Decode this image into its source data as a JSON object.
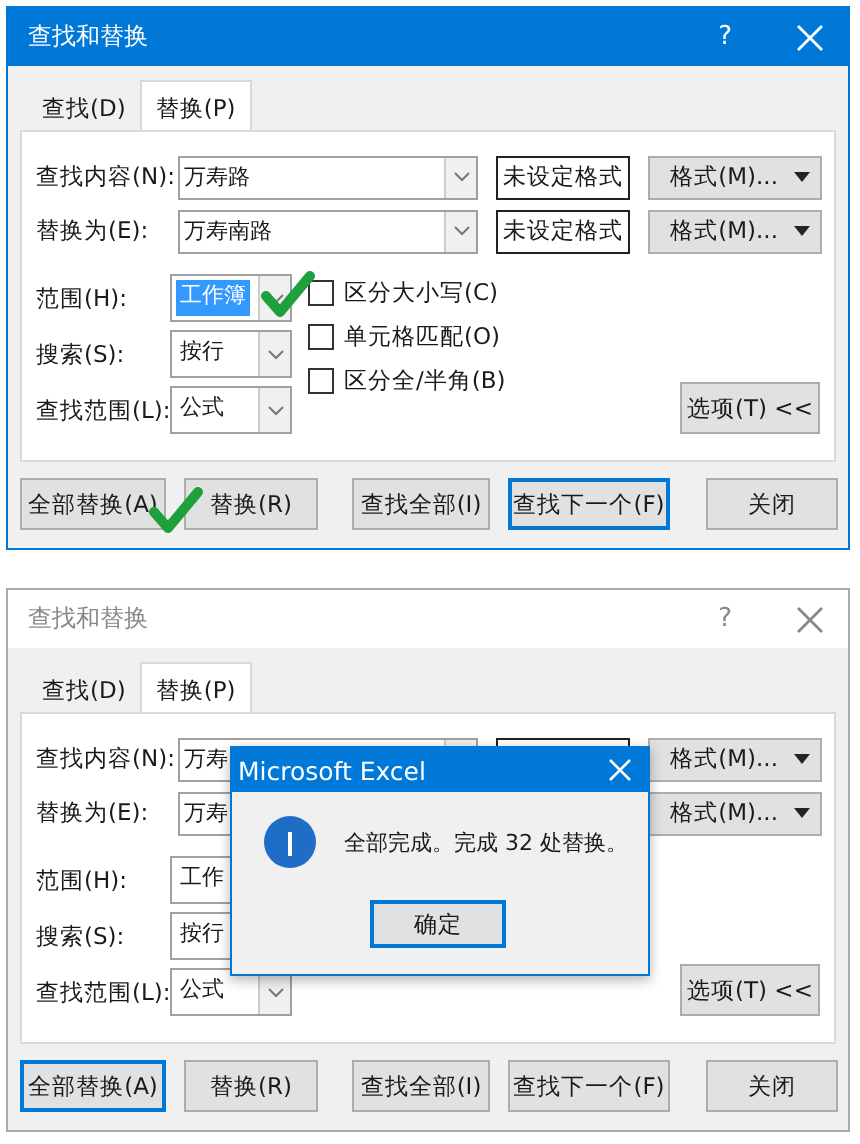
{
  "dialogs": [
    {
      "title": "查找和替换",
      "active": true,
      "help": "?",
      "tabs": [
        {
          "label": "查找(D)",
          "selected": false
        },
        {
          "label": "替换(P)",
          "selected": true
        }
      ],
      "fields": [
        {
          "label": "查找内容(N):",
          "value": "万寿路",
          "format_preview": "未设定格式",
          "format_button": "格式(M)..."
        },
        {
          "label": "替换为(E):",
          "value": "万寿南路",
          "format_preview": "未设定格式",
          "format_button": "格式(M)..."
        }
      ],
      "options": [
        {
          "label": "范围(H):",
          "value": "工作簿",
          "highlighted": true,
          "check_mark": true
        },
        {
          "label": "搜索(S):",
          "value": "按行",
          "highlighted": false,
          "check_mark": false
        },
        {
          "label": "查找范围(L):",
          "value": "公式",
          "highlighted": false,
          "check_mark": false
        }
      ],
      "checkboxes": [
        {
          "label": "区分大小写(C)",
          "checked": false
        },
        {
          "label": "单元格匹配(O)",
          "checked": false
        },
        {
          "label": "区分全/半角(B)",
          "checked": false
        }
      ],
      "options_button": "选项(T) <<",
      "buttons": [
        {
          "label": "全部替换(A)",
          "default": false,
          "check_mark": true
        },
        {
          "label": "替换(R)",
          "default": false,
          "check_mark": false
        },
        {
          "label": "查找全部(I)",
          "default": false,
          "check_mark": false
        },
        {
          "label": "查找下一个(F)",
          "default": true,
          "check_mark": false
        },
        {
          "label": "关闭",
          "default": false,
          "check_mark": false
        }
      ]
    },
    {
      "title": "查找和替换",
      "active": false,
      "help": "?",
      "tabs": [
        {
          "label": "查找(D)",
          "selected": false
        },
        {
          "label": "替换(P)",
          "selected": true
        }
      ],
      "fields": [
        {
          "label": "查找内容(N):",
          "value": "万寿",
          "format_button": "格式(M)..."
        },
        {
          "label": "替换为(E):",
          "value": "万寿",
          "preview_hidden": true,
          "format_button": "格式(M)..."
        }
      ],
      "options": [
        {
          "label": "范围(H):",
          "value": "工作",
          "highlighted": false,
          "check_mark": false
        },
        {
          "label": "搜索(S):",
          "value": "按行",
          "highlighted": false,
          "check_mark": false
        },
        {
          "label": "查找范围(L):",
          "value": "公式",
          "highlighted": false,
          "check_mark": false
        }
      ],
      "options_button": "选项(T) <<",
      "buttons": [
        {
          "label": "全部替换(A)",
          "default": true,
          "check_mark": false
        },
        {
          "label": "替换(R)",
          "default": false,
          "check_mark": false
        },
        {
          "label": "查找全部(I)",
          "default": false,
          "check_mark": false
        },
        {
          "label": "查找下一个(F)",
          "default": false,
          "check_mark": false
        },
        {
          "label": "关闭",
          "default": false,
          "check_mark": false
        }
      ],
      "message_box": {
        "title": "Microsoft Excel",
        "text": "全部完成。完成 32 处替换。",
        "button": "确定"
      }
    }
  ]
}
